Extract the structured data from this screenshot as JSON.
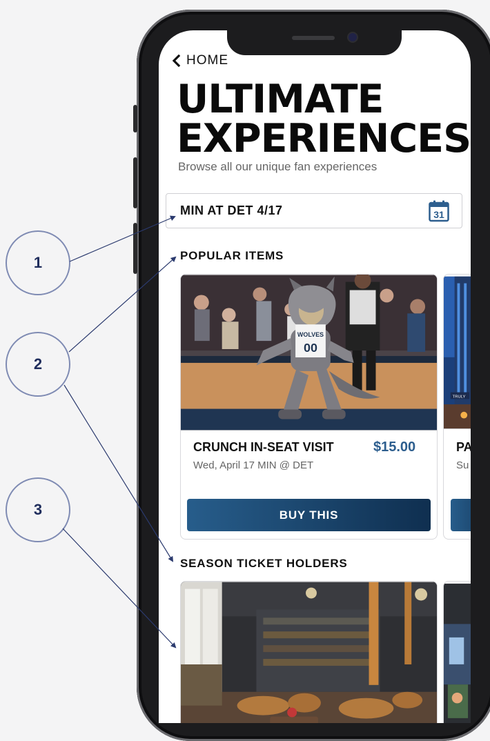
{
  "annotations": [
    "1",
    "2",
    "3"
  ],
  "nav": {
    "back_label": "HOME",
    "back_icon": "chevron-left-icon"
  },
  "header": {
    "title_line1": "ULTIMATE",
    "title_line2": "EXPERIENCES",
    "subtitle": "Browse all our unique fan experiences"
  },
  "game_selector": {
    "value": "MIN AT DET 4/17",
    "calendar_day": "31",
    "icon": "calendar-icon"
  },
  "sections": {
    "popular": {
      "title": "POPULAR ITEMS",
      "items": [
        {
          "name": "CRUNCH IN-SEAT VISIT",
          "price": "$15.00",
          "date": "Wed, April 17 MIN @ DET",
          "button": "BUY THIS"
        },
        {
          "name": "PA",
          "date": "Su"
        }
      ]
    },
    "season": {
      "title": "SEASON TICKET HOLDERS"
    }
  },
  "colors": {
    "accent": "#2d5e8e",
    "button_start": "#275d8b",
    "button_end": "#0f2f50",
    "annotation": "#1f2d5c"
  }
}
